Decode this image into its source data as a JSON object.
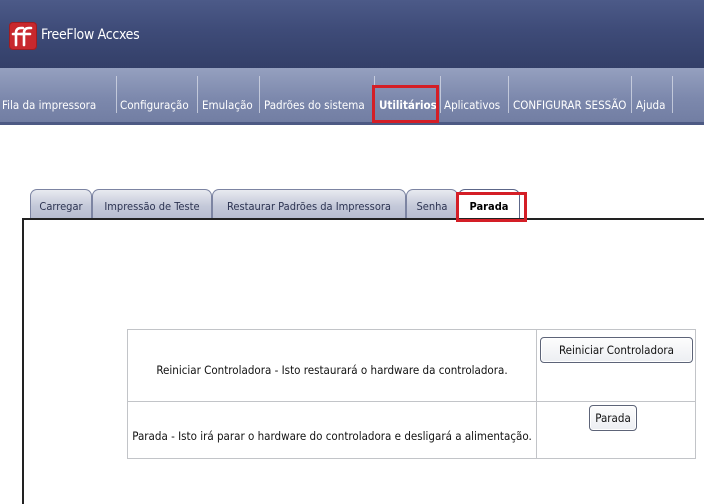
{
  "app": {
    "title": "FreeFlow Accxes",
    "logo_icon": "freeflow-logo-icon",
    "logo_color": "#c8282d"
  },
  "nav": {
    "items": [
      {
        "label": "Fila da impressora"
      },
      {
        "label": "Configuração"
      },
      {
        "label": "Emulação"
      },
      {
        "label": "Padrões do sistema"
      },
      {
        "label": "Utilitários",
        "selected": true
      },
      {
        "label": "Aplicativos"
      },
      {
        "label": "CONFIGURAR SESSÃO"
      },
      {
        "label": "Ajuda"
      }
    ]
  },
  "tabs": {
    "items": [
      {
        "label": "Carregar"
      },
      {
        "label": "Impressão de Teste"
      },
      {
        "label": "Restaurar Padrões da Impressora"
      },
      {
        "label": "Senha"
      },
      {
        "label": "Parada",
        "selected": true
      }
    ]
  },
  "actions": {
    "rows": [
      {
        "description": "Reiniciar Controladora - Isto restaurará o hardware da controladora.",
        "button_label": "Reiniciar  Controladora"
      },
      {
        "description": "Parada - Isto irá parar o hardware do controladora e desligará a alimentação.",
        "button_label": "Parada"
      }
    ]
  },
  "colors": {
    "highlight": "#d41e26",
    "titlebar": "#3e4b78",
    "navbar": "#7d89ad"
  }
}
